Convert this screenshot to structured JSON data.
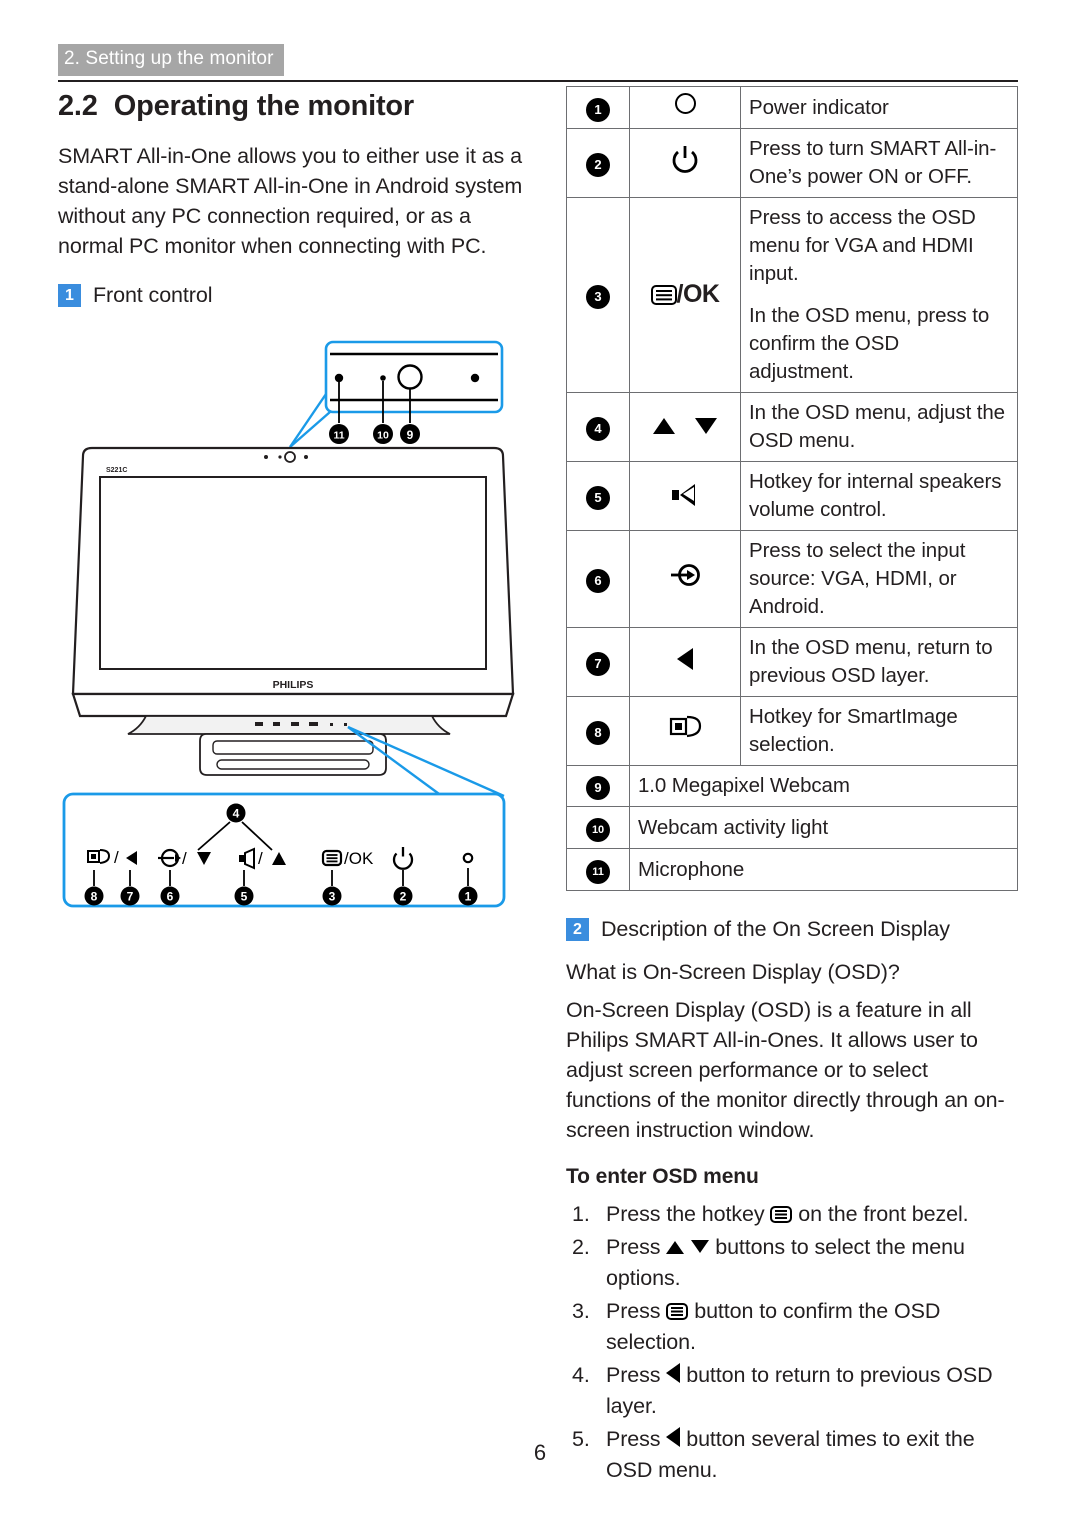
{
  "header": {
    "tag": "2. Setting up the monitor"
  },
  "section": {
    "number": "2.2",
    "title": "Operating the monitor",
    "intro": "SMART All-in-One allows you to either use it as a stand-alone SMART All-in-One in Android system without any PC connection required, or as a normal PC monitor when connecting with PC."
  },
  "front_control": {
    "badge": "1",
    "label": "Front control",
    "monitor_model": "S221C",
    "brand": "PHILIPS",
    "callout_top_labels": [
      "11",
      "10",
      "9"
    ],
    "callout_bottom_top_label": "4",
    "bezel_buttons": [
      {
        "label": "8",
        "glyph": "smartimage/left"
      },
      {
        "label": "7",
        "glyph": "left"
      },
      {
        "label": "6",
        "glyph": "input/down"
      },
      {
        "label": "5",
        "glyph": "speaker/up"
      },
      {
        "label": "3",
        "glyph": "osd/OK"
      },
      {
        "label": "2",
        "glyph": "power"
      },
      {
        "label": "1",
        "glyph": "indicator"
      }
    ],
    "bezel_labels": [
      "/",
      "/OK",
      "OK"
    ]
  },
  "table": {
    "rows": [
      {
        "num": "1",
        "icon": "power-indicator-icon",
        "desc": "Power indicator",
        "full": false
      },
      {
        "num": "2",
        "icon": "power-button-icon",
        "desc": "Press to turn SMART All-in-One’s power ON or OFF.",
        "full": false
      },
      {
        "num": "3",
        "icon": "osd-ok-icon",
        "icon_text": "/OK",
        "desc": "Press to access the OSD menu for VGA and HDMI input.",
        "desc2": "In the OSD menu, press to confirm the OSD adjustment.",
        "full": false
      },
      {
        "num": "4",
        "icon": "up-down-arrows-icon",
        "desc": "In the OSD menu, adjust the OSD menu.",
        "full": false
      },
      {
        "num": "5",
        "icon": "speaker-icon",
        "desc": "Hotkey for internal speakers volume control.",
        "full": false
      },
      {
        "num": "6",
        "icon": "input-source-icon",
        "desc": "Press to select the input source: VGA, HDMI, or Android.",
        "full": false
      },
      {
        "num": "7",
        "icon": "left-arrow-icon",
        "desc": "In the OSD menu, return to previous OSD layer.",
        "full": false
      },
      {
        "num": "8",
        "icon": "smartimage-icon",
        "desc": "Hotkey for SmartImage selection.",
        "full": false
      },
      {
        "num": "9",
        "icon": "",
        "desc": "1.0 Megapixel Webcam",
        "full": true
      },
      {
        "num": "10",
        "icon": "",
        "desc": "Webcam activity light",
        "full": true
      },
      {
        "num": "11",
        "icon": "",
        "desc": "Microphone",
        "full": true
      }
    ]
  },
  "osd": {
    "badge": "2",
    "badge_label": "Description of the On Screen Display",
    "question_head": "What is On-Screen Display (OSD)?",
    "question_body": "On-Screen Display (OSD) is a feature in all Philips SMART All-in-Ones. It allows user to adjust screen performance or to select functions of the monitor directly through an on-screen instruction window.",
    "enter_head": "To enter OSD menu",
    "steps": [
      {
        "pre": "Press the hotkey ",
        "icon": "osd-icon",
        "post": " on the front bezel."
      },
      {
        "pre": "Press ",
        "icon": "up-down-icon",
        "post": " buttons to select the menu options."
      },
      {
        "pre": "Press ",
        "icon": "osd-icon",
        "post": " button to confirm the OSD selection."
      },
      {
        "pre": "Press ",
        "icon": "left-arrow-icon",
        "post": " button to return to previous OSD layer."
      },
      {
        "pre": "Press ",
        "icon": "left-arrow-icon",
        "post": " button several times to exit the OSD menu."
      }
    ]
  },
  "footer": {
    "page_number": "6"
  },
  "colors": {
    "header_tag_bg": "#a6a6a6",
    "badge_blue": "#3a8dde",
    "callout_blue": "#1a9ae8",
    "rule_black": "#231f20",
    "table_border": "#6d6e71"
  }
}
